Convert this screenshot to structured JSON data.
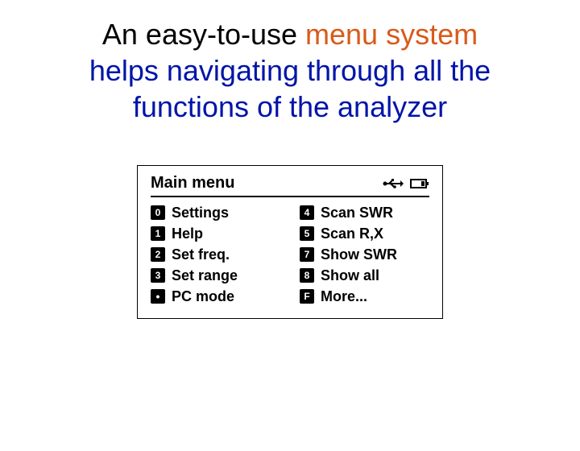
{
  "headline": {
    "part1_a": "An easy-to-use ",
    "accent": "menu system",
    "part2": "helps navigating through all the functions of the analyzer"
  },
  "lcd": {
    "title": "Main menu",
    "left": [
      {
        "key": "0",
        "label": "Settings"
      },
      {
        "key": "1",
        "label": "Help"
      },
      {
        "key": "2",
        "label": "Set freq."
      },
      {
        "key": "3",
        "label": "Set range"
      },
      {
        "key": "•",
        "label": "PC mode"
      }
    ],
    "right": [
      {
        "key": "4",
        "label": "Scan SWR"
      },
      {
        "key": "5",
        "label": "Scan R,X"
      },
      {
        "key": "7",
        "label": "Show SWR"
      },
      {
        "key": "8",
        "label": "Show all"
      },
      {
        "key": "F",
        "label": "More..."
      }
    ]
  }
}
